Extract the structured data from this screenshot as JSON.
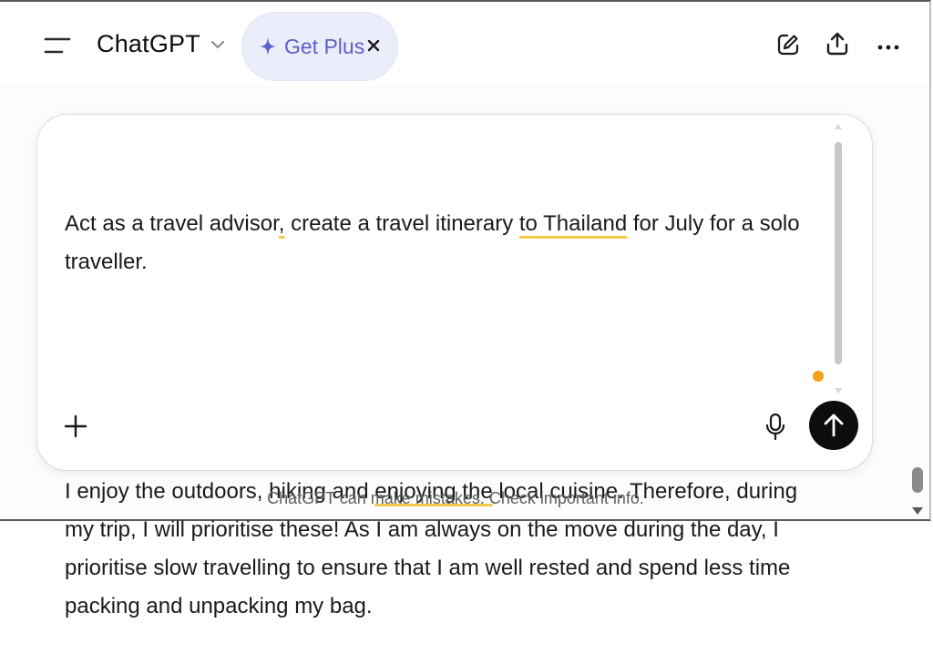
{
  "header": {
    "model_name": "ChatGPT",
    "upsell": {
      "label": "Get Plus"
    },
    "icons": {
      "menu": "menu-icon",
      "model_dropdown": "chevron-down-icon",
      "upsell": "sparkle-icon",
      "dismiss": "close-icon",
      "new_chat": "edit-icon",
      "share": "share-icon",
      "more": "more-icon"
    }
  },
  "composer": {
    "prompt": {
      "p1": [
        "Act as a travel advisor",
        ",",
        " create a travel itinerary ",
        "to Thailand",
        " for July for a solo traveller."
      ],
      "p2": [
        "I enjoy the outdoors, hiking and ",
        "enjoying the",
        " local cuisine. Therefore, during my trip, I will prioritise these! As I am always on the move during the day, I prioritise slow travelling to ensure that I am well rested and spend less time packing and unpacking my bag."
      ]
    },
    "icons": {
      "attach": "plus-icon",
      "voice": "microphone-icon",
      "send": "arrow-up-icon"
    },
    "colors": {
      "spellcheck_underline": "#f2c94c",
      "status_dot": "#f6a01a",
      "send_button": "#0d0d0d"
    }
  },
  "footer": {
    "disclaimer": "ChatGPT can make mistakes. Check important info."
  },
  "colors": {
    "upsell_bg": "#ecedfb",
    "upsell_text": "#5b5fc7"
  }
}
